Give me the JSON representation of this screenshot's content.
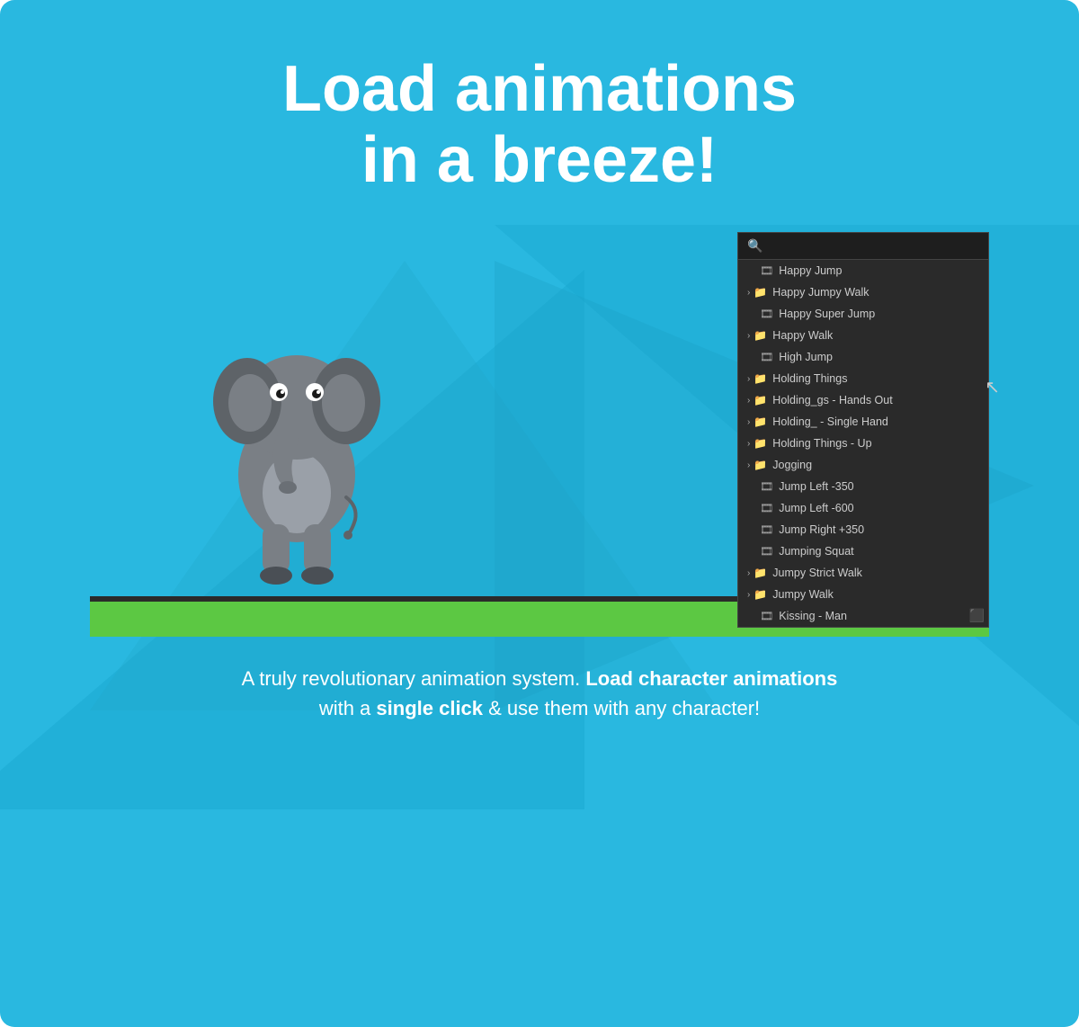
{
  "header": {
    "line1": "Load animations",
    "line2": "in a breeze!"
  },
  "search": {
    "placeholder": "🔍"
  },
  "animation_list": {
    "items": [
      {
        "type": "anim",
        "label": "Happy Jump",
        "indent": 1
      },
      {
        "type": "folder",
        "label": "Happy Jumpy Walk",
        "indent": 1,
        "expanded": false
      },
      {
        "type": "anim",
        "label": "Happy Super Jump",
        "indent": 1
      },
      {
        "type": "folder",
        "label": "Happy Walk",
        "indent": 1,
        "expanded": false
      },
      {
        "type": "anim",
        "label": "High Jump",
        "indent": 1
      },
      {
        "type": "folder",
        "label": "Holding Things",
        "indent": 1,
        "expanded": false
      },
      {
        "type": "folder",
        "label": "Holding_gs - Hands Out",
        "indent": 1,
        "expanded": false
      },
      {
        "type": "folder",
        "label": "Holding_ - Single Hand",
        "indent": 1,
        "expanded": false
      },
      {
        "type": "folder",
        "label": "Holding Things - Up",
        "indent": 1,
        "expanded": false
      },
      {
        "type": "folder",
        "label": "Jogging",
        "indent": 1,
        "expanded": false
      },
      {
        "type": "anim",
        "label": "Jump Left -350",
        "indent": 1
      },
      {
        "type": "anim",
        "label": "Jump Left -600",
        "indent": 1
      },
      {
        "type": "anim",
        "label": "Jump Right +350",
        "indent": 1
      },
      {
        "type": "anim",
        "label": "Jumping Squat",
        "indent": 1
      },
      {
        "type": "folder",
        "label": "Jumpy Strict Walk",
        "indent": 1,
        "expanded": false
      },
      {
        "type": "folder",
        "label": "Jumpy Walk",
        "indent": 1,
        "expanded": false
      },
      {
        "type": "anim",
        "label": "Kissing - Man",
        "indent": 1
      }
    ]
  },
  "bottom_text": {
    "prefix": "A truly revolutionary animation system. ",
    "bold1": "Load character animations",
    "middle": " with a ",
    "bold2": "single click",
    "suffix": " & use them with any character!"
  }
}
